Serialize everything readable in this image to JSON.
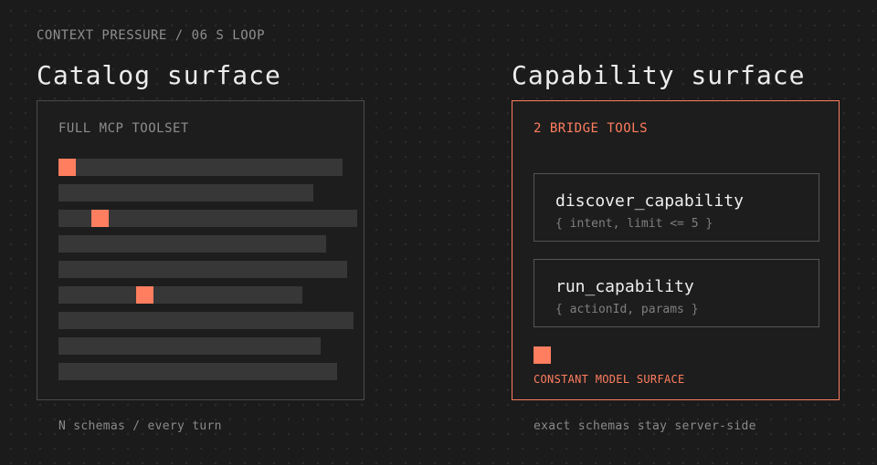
{
  "eyebrow": "CONTEXT PRESSURE / 06 S LOOP",
  "catalog": {
    "title": "Catalog surface",
    "kicker": "FULL MCP TOOLSET",
    "caption": "N schemas / every turn"
  },
  "capability": {
    "title": "Capability surface",
    "kicker": "2 BRIDGE TOOLS",
    "tools": [
      {
        "name": "discover_capability",
        "params": "{ intent, limit <= 5 }"
      },
      {
        "name": "run_capability",
        "params": "{ actionId, params }"
      }
    ],
    "constant_label": "CONSTANT MODEL SURFACE",
    "caption": "exact schemas stay server-side"
  },
  "colors": {
    "accent": "#ff7e5f",
    "background": "#1b1b1b",
    "bar": "#373737"
  }
}
